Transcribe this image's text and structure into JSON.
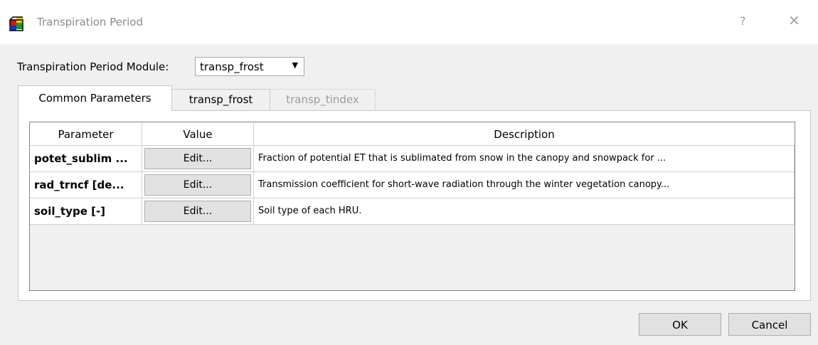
{
  "window": {
    "title": "Transpiration Period",
    "help_glyph": "?",
    "close_glyph": "×"
  },
  "module": {
    "label": "Transpiration Period Module:",
    "selected": "transp_frost"
  },
  "tabs": [
    {
      "label": "Common Parameters",
      "state": "active"
    },
    {
      "label": "transp_frost",
      "state": "normal"
    },
    {
      "label": "transp_tindex",
      "state": "disabled"
    }
  ],
  "table": {
    "headers": [
      "Parameter",
      "Value",
      "Description"
    ],
    "rows": [
      {
        "parameter": "potet_sublim ...",
        "value": "Edit...",
        "description": "Fraction of potential ET that is sublimated from snow in the canopy and snowpack for ..."
      },
      {
        "parameter": "rad_trncf  [de...",
        "value": "Edit...",
        "description": "Transmission coefficient for short-wave radiation through the winter vegetation canopy..."
      },
      {
        "parameter": "soil_type [-]",
        "value": "Edit...",
        "description": "Soil type of each HRU."
      }
    ]
  },
  "buttons": {
    "ok": "OK",
    "cancel": "Cancel"
  },
  "colors": {
    "dialog_bg": "#f0f0f0",
    "button_bg": "#e1e1e1",
    "disabled_text": "#9a9a9a"
  }
}
